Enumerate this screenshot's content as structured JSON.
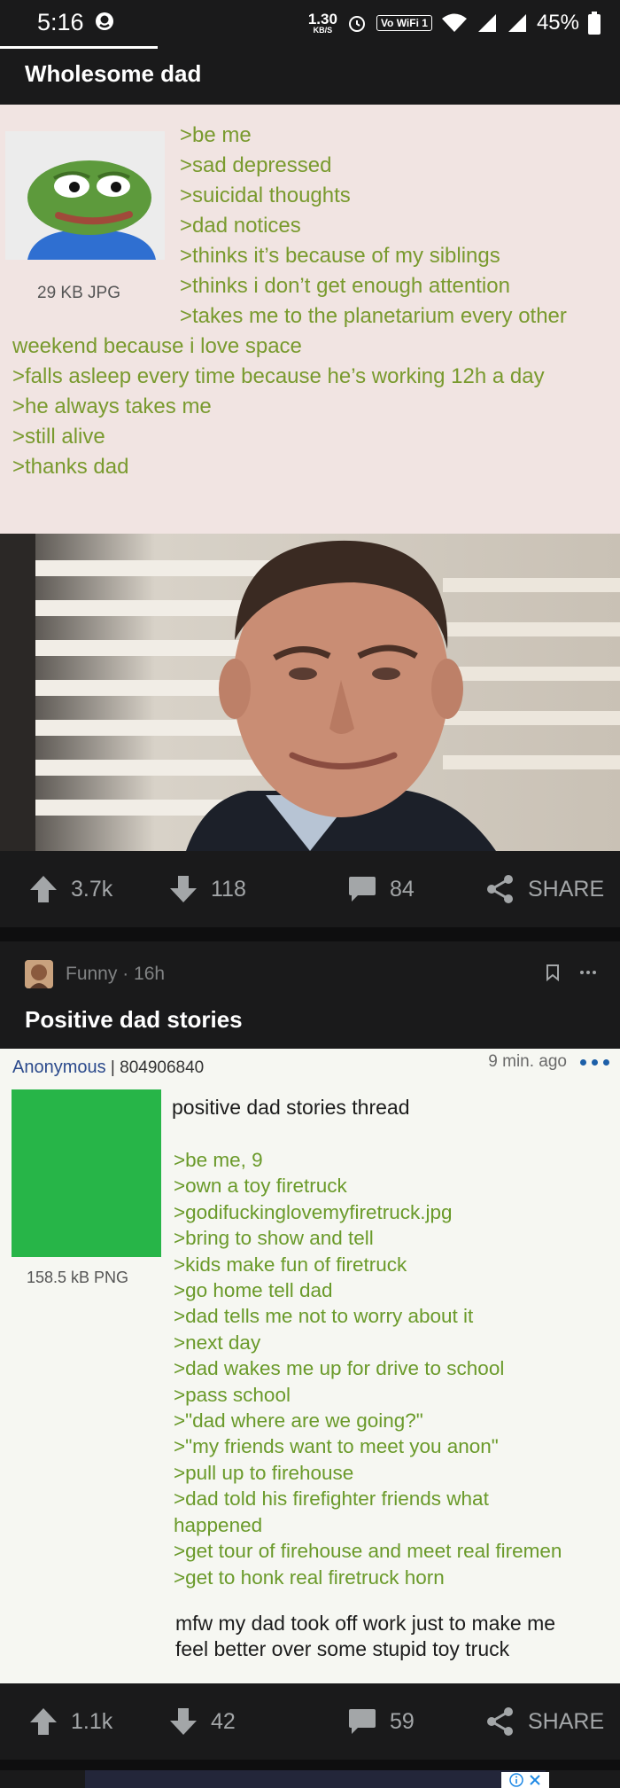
{
  "status_bar": {
    "time": "5:16",
    "net_speed": "1.30",
    "net_unit": "KB/S",
    "wifi_badge": "Vo WiFi 1",
    "battery": "45%"
  },
  "post1": {
    "title": "Wholesome dad",
    "file_size": "29 KB JPG",
    "lines_right": [
      ">be me",
      ">sad depressed",
      ">suicidal thoughts",
      ">dad notices",
      ">thinks it’s because of my siblings",
      ">thinks i don’t get enough attention",
      ">takes me to the planetarium every other"
    ],
    "lines_full": [
      "weekend because i love space",
      ">falls asleep every time because he’s working 12h a day",
      ">he always takes me",
      ">still alive",
      "",
      ">thanks dad"
    ],
    "upvotes": "3.7k",
    "downvotes": "118",
    "comments": "84",
    "share_label": "SHARE"
  },
  "post2": {
    "subreddit": "Funny",
    "age": "16h",
    "title": "Positive dad stories",
    "anon_name": "Anonymous",
    "post_number": "804906840",
    "time_ago": "9 min. ago",
    "file_size": "158.5 kB PNG",
    "thread_title": "positive dad stories thread",
    "lines": [
      ">be me, 9",
      ">own a toy firetruck",
      ">godifuckinglovemyfiretruck.jpg",
      ">bring to show and tell",
      ">kids make fun of firetruck",
      ">go home tell dad",
      ">dad tells me not to worry about it",
      ">next day",
      ">dad wakes me up for drive to school",
      ">pass school",
      ">\"dad where are we going?\"",
      ">\"my friends want to meet you anon\"",
      ">pull up to firehouse",
      ">dad told his firefighter friends what",
      "happened",
      ">get tour of firehouse and meet real firemen",
      ">get to honk real firetruck horn"
    ],
    "footer": "mfw my dad took off work just to make me\nfeel better over some stupid toy truck",
    "upvotes": "1.1k",
    "downvotes": "42",
    "comments": "59",
    "share_label": "SHARE"
  },
  "icons": [
    "upvote-icon",
    "downvote-icon",
    "comment-icon",
    "share-icon",
    "bookmark-icon",
    "more-icon",
    "info-icon",
    "close-icon"
  ]
}
